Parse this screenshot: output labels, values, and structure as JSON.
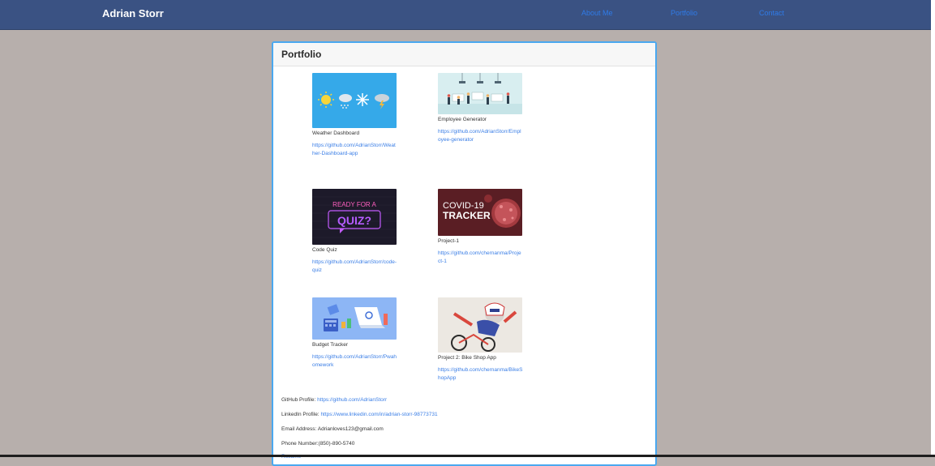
{
  "navbar": {
    "brand": "Adrian Storr",
    "links": [
      "About Me",
      "Portfolio",
      "Contact"
    ]
  },
  "portfolio": {
    "title": "Portfolio",
    "projects": [
      {
        "title": "Weather Dashboard",
        "link": "https://github.com/AdrianStorr/Weather-Dashboard-app"
      },
      {
        "title": "Employee Generator",
        "link": "https://github.com/AdrianStorr/Employee-generator"
      },
      {
        "title": "Code Quiz",
        "link": "https://github.com/AdrianStorr/code-quiz"
      },
      {
        "title": "Project-1",
        "link": "https://github.com/chernanma/Project-1"
      },
      {
        "title": "Budget Tracker",
        "link": "https://github.com/AdrianStorr/Pwahomework"
      },
      {
        "title": "Project 2: Bike Shop App",
        "link": "https://github.com/chernanma/BikeShopApp"
      }
    ],
    "thumbnails": {
      "quiz_text_1": "READY FOR A",
      "quiz_text_2": "QUIZ?",
      "covid_text_1": "COVID-19",
      "covid_text_2": "TRACKER"
    }
  },
  "contact": {
    "github_label": "GitHub Profile:",
    "github_url": "https://github.com/AdrianStorr",
    "linkedin_label": "LinkedIn Profile:",
    "linkedin_url": "https://www.linkedin.com/in/adrian-storr-98773731",
    "email": "Email Address: Adrianloves123@gmail.com",
    "phone": "Phone Number:(850)-890-5740",
    "resume": "Resume"
  },
  "colors": {
    "navbar": "#3a5283",
    "link": "#2f7be8",
    "card_border": "#4aa8f0",
    "page_bg": "#b7afac"
  }
}
